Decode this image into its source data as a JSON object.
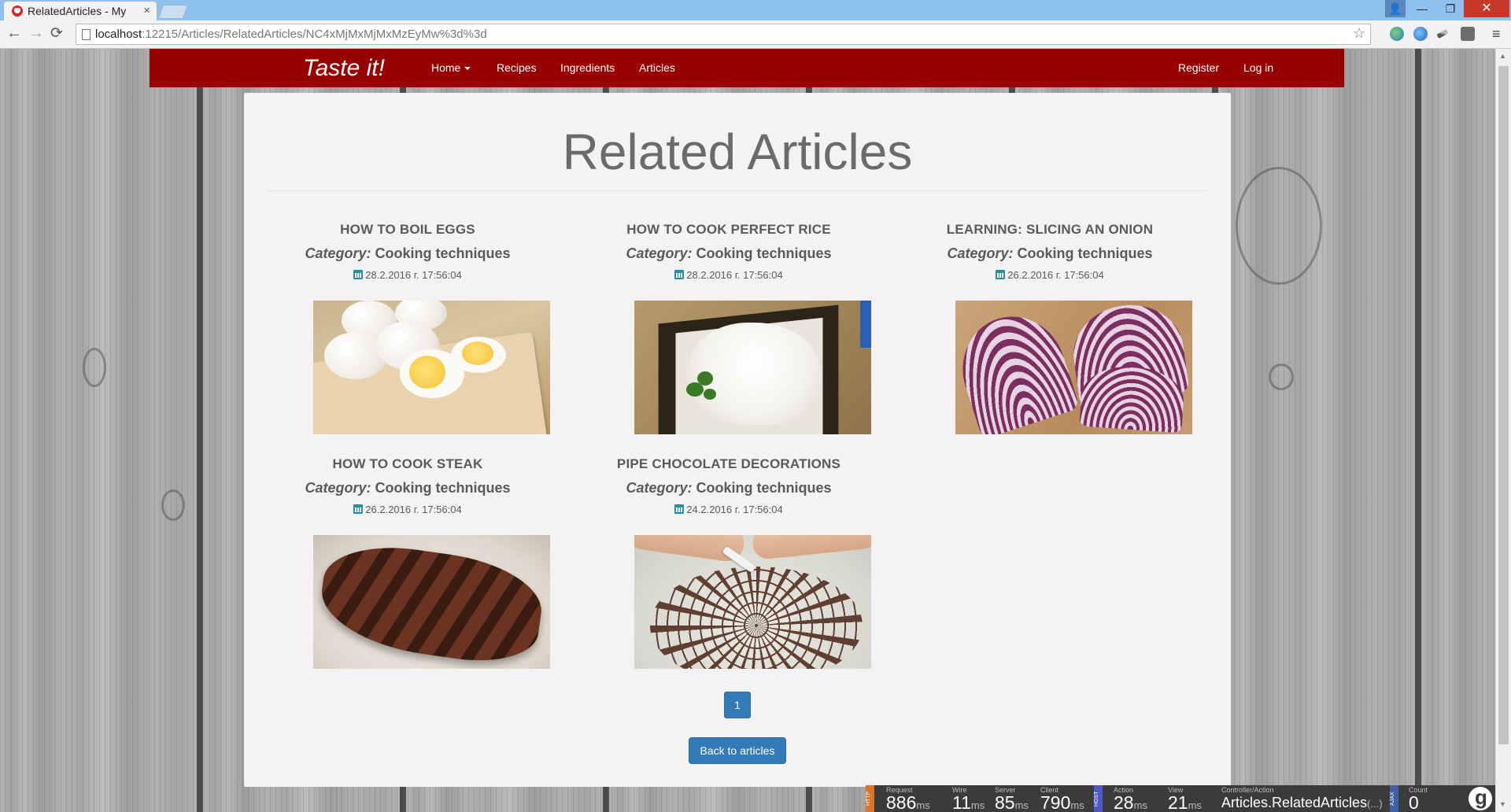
{
  "browser": {
    "tab_title": "RelatedArticles - My",
    "tab_close": "×",
    "url_host": "localhost",
    "url_path": ":12215/Articles/RelatedArticles/NC4xMjMxMjMxMzEyMw%3d%3d",
    "bookmark_star": "☆",
    "back": "←",
    "forward": "→",
    "reload": "⟳",
    "menu": "≡",
    "window_minimize": "—",
    "window_maximize": "❐",
    "window_close": "✕",
    "user_icon": "👤"
  },
  "navbar": {
    "brand": "Taste it!",
    "items": [
      "Home",
      "Recipes",
      "Ingredients",
      "Articles"
    ],
    "right_items": [
      "Register",
      "Log in"
    ],
    "color": "#980000"
  },
  "page": {
    "title": "Related Articles",
    "articles": [
      {
        "title": "HOW TO BOIL EGGS",
        "category_label": "Category:",
        "category": "Cooking techniques",
        "date": "28.2.2016 г. 17:56:04",
        "image": "boiled-eggs-image"
      },
      {
        "title": "HOW TO COOK PERFECT RICE",
        "category_label": "Category:",
        "category": "Cooking techniques",
        "date": "28.2.2016 г. 17:56:04",
        "image": "rice-image"
      },
      {
        "title": "LEARNING: SLICING AN ONION",
        "category_label": "Category:",
        "category": "Cooking techniques",
        "date": "26.2.2016 г. 17:56:04",
        "image": "onion-image"
      },
      {
        "title": "HOW TO COOK STEAK",
        "category_label": "Category:",
        "category": "Cooking techniques",
        "date": "26.2.2016 г. 17:56:04",
        "image": "steak-image"
      },
      {
        "title": "PIPE CHOCOLATE DECORATIONS",
        "category_label": "Category:",
        "category": "Cooking techniques",
        "date": "24.2.2016 г. 17:56:04",
        "image": "chocolate-decoration-image"
      }
    ],
    "pager": [
      "1"
    ],
    "back_button": "Back to articles",
    "accent": "#337ab7"
  },
  "glimpse": {
    "http_tag": "HTTP",
    "host_tag": "HOST",
    "ajax_tag": "AJAX",
    "request": {
      "label": "Request",
      "value": "886",
      "unit": "ms"
    },
    "wire": {
      "label": "Wire",
      "value": "11",
      "unit": "ms"
    },
    "server": {
      "label": "Server",
      "value": "85",
      "unit": "ms"
    },
    "client": {
      "label": "Client",
      "value": "790",
      "unit": "ms"
    },
    "action": {
      "label": "Action",
      "value": "28",
      "unit": "ms"
    },
    "view": {
      "label": "View",
      "value": "21",
      "unit": "ms"
    },
    "controller_action": {
      "label": "Controller/Action",
      "value": "Articles.RelatedArticles",
      "suffix": "(...)"
    },
    "count": {
      "label": "Count",
      "value": "0"
    }
  }
}
